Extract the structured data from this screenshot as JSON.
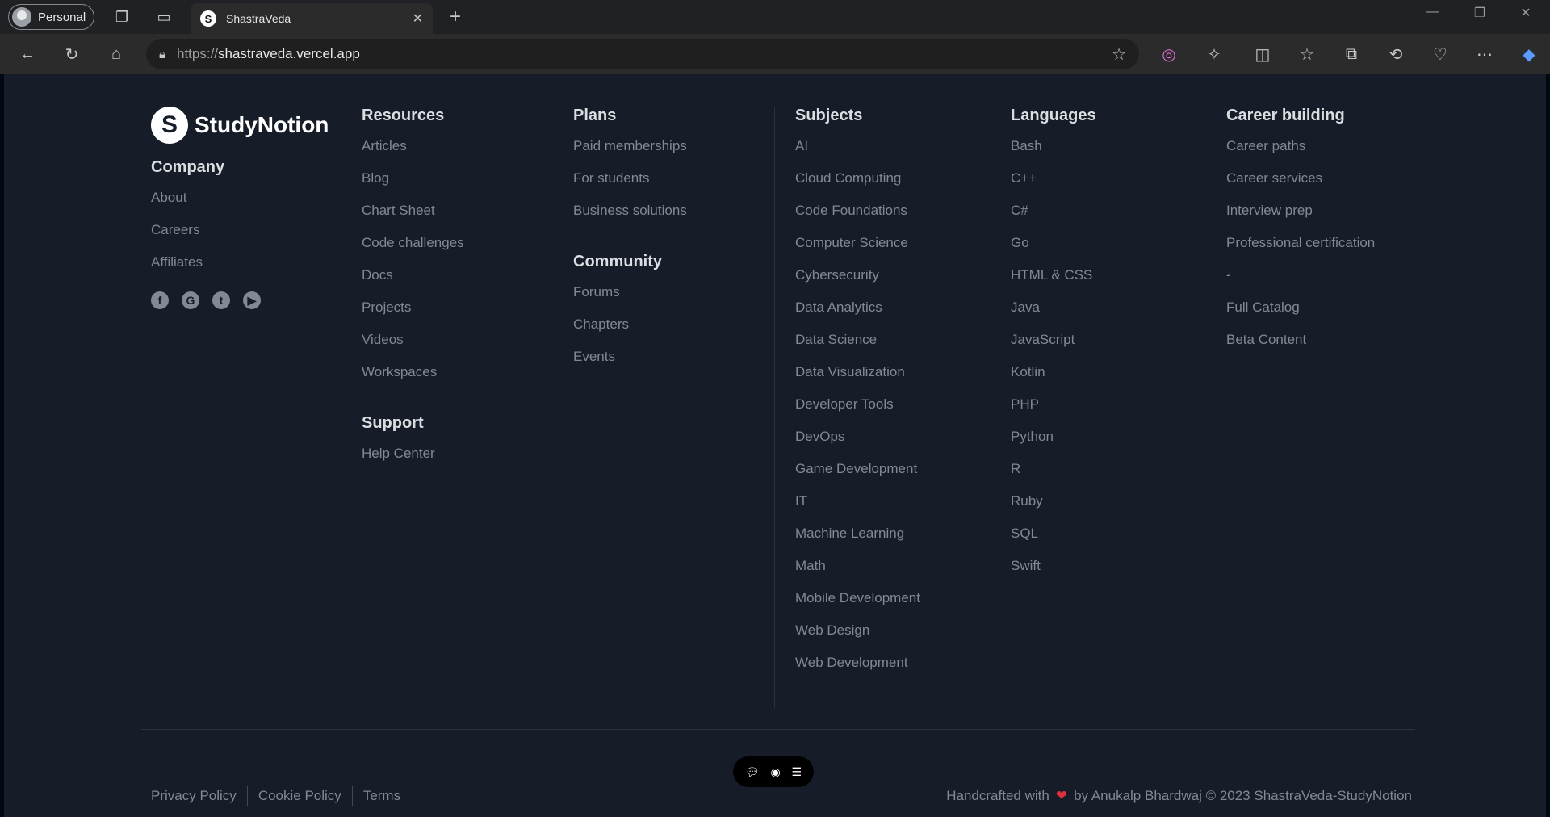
{
  "browser": {
    "profile_label": "Personal",
    "tab_title": "ShastraVeda",
    "tab_favicon": "S",
    "url_scheme": "https://",
    "url_host": "shastraveda.vercel.app"
  },
  "brand": {
    "mark": "S",
    "name": "StudyNotion"
  },
  "company": {
    "heading": "Company",
    "links": [
      "About",
      "Careers",
      "Affiliates"
    ],
    "social": [
      "f",
      "G",
      "t",
      "▶"
    ]
  },
  "resources": {
    "heading": "Resources",
    "links": [
      "Articles",
      "Blog",
      "Chart Sheet",
      "Code challenges",
      "Docs",
      "Projects",
      "Videos",
      "Workspaces"
    ]
  },
  "support": {
    "heading": "Support",
    "links": [
      "Help Center"
    ]
  },
  "plans": {
    "heading": "Plans",
    "links": [
      "Paid memberships",
      "For students",
      "Business solutions"
    ]
  },
  "community": {
    "heading": "Community",
    "links": [
      "Forums",
      "Chapters",
      "Events"
    ]
  },
  "subjects": {
    "heading": "Subjects",
    "links": [
      "AI",
      "Cloud Computing",
      "Code Foundations",
      "Computer Science",
      "Cybersecurity",
      "Data Analytics",
      "Data Science",
      "Data Visualization",
      "Developer Tools",
      "DevOps",
      "Game Development",
      "IT",
      "Machine Learning",
      "Math",
      "Mobile Development",
      "Web Design",
      "Web Development"
    ]
  },
  "languages": {
    "heading": "Languages",
    "links": [
      "Bash",
      "C++",
      "C#",
      "Go",
      "HTML & CSS",
      "Java",
      "JavaScript",
      "Kotlin",
      "PHP",
      "Python",
      "R",
      "Ruby",
      "SQL",
      "Swift"
    ]
  },
  "career": {
    "heading": "Career building",
    "links": [
      "Career paths",
      "Career services",
      "Interview prep",
      "Professional certification",
      "-",
      "Full Catalog",
      "Beta Content"
    ]
  },
  "footer": {
    "legal": [
      "Privacy Policy",
      "Cookie Policy",
      "Terms"
    ],
    "credit_prefix": "Handcrafted with",
    "credit_suffix": "by Anukalp Bhardwaj © 2023 ShastraVeda-StudyNotion"
  }
}
